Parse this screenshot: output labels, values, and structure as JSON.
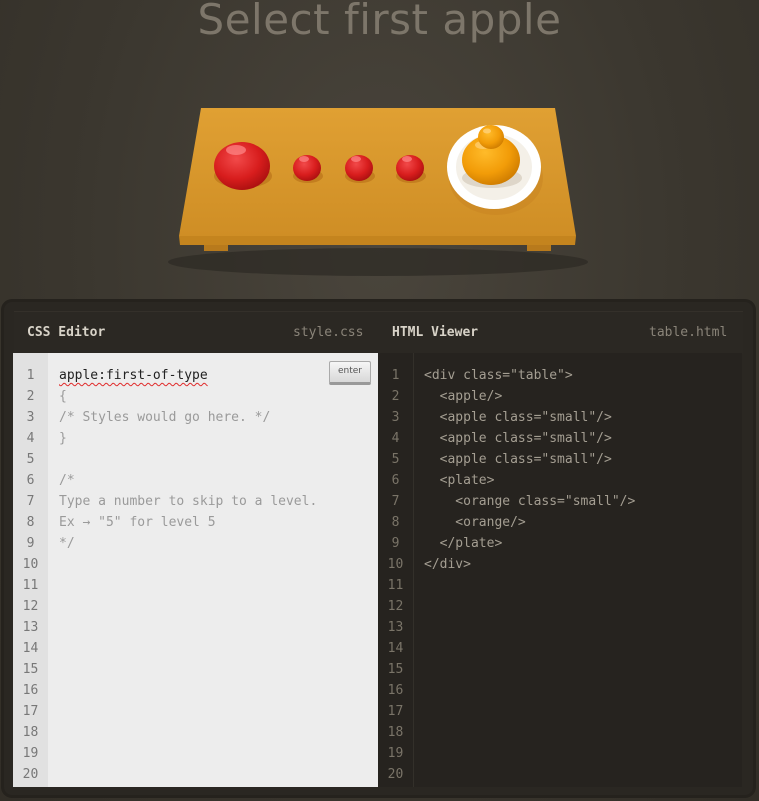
{
  "instruction": "Select first apple",
  "css_editor": {
    "title": "CSS Editor",
    "filename": "style.css",
    "enter_label": "enter",
    "input_value": "apple:first-of-type",
    "lines": [
      "apple:first-of-type",
      "{",
      "/* Styles would go here. */",
      "}",
      "",
      "/*",
      "Type a number to skip to a level.",
      "Ex → \"5\" for level 5",
      "*/"
    ],
    "line_numbers": [
      "1",
      "2",
      "3",
      "4",
      "5",
      "6",
      "7",
      "8",
      "9",
      "10",
      "11",
      "12",
      "13",
      "14",
      "15",
      "16",
      "17",
      "18",
      "19",
      "20"
    ]
  },
  "html_viewer": {
    "title": "HTML Viewer",
    "filename": "table.html",
    "lines": [
      "<div class=\"table\">",
      "  <apple/>",
      "  <apple class=\"small\"/>",
      "  <apple class=\"small\"/>",
      "  <apple class=\"small\"/>",
      "  <plate>",
      "    <orange class=\"small\"/>",
      "    <orange/>",
      "  </plate>",
      "</div>"
    ],
    "line_numbers": [
      "1",
      "2",
      "3",
      "4",
      "5",
      "6",
      "7",
      "8",
      "9",
      "10",
      "11",
      "12",
      "13",
      "14",
      "15",
      "16",
      "17",
      "18",
      "19",
      "20"
    ]
  },
  "colors": {
    "table": "#d9962c",
    "apple": "#d41f1f",
    "orange": "#f09a0a",
    "plate": "#ffffff"
  }
}
